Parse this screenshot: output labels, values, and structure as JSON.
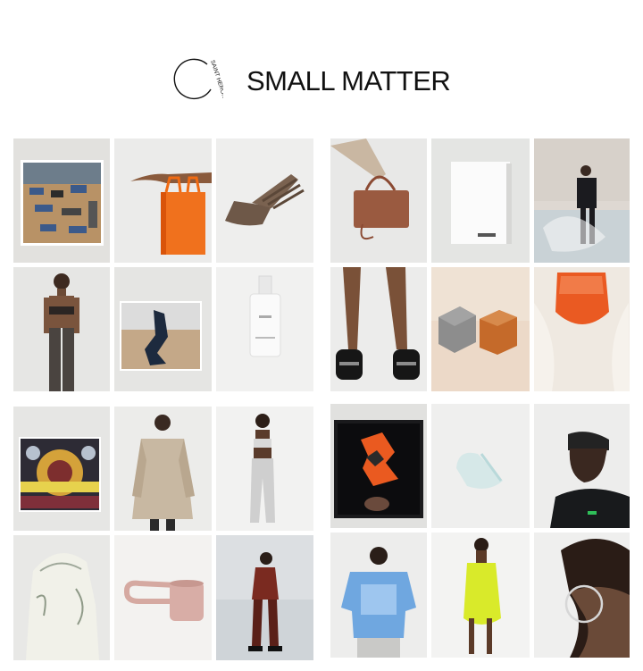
{
  "header": {
    "title": "SMALL MATTER",
    "logo_text": "SAINT HERON"
  },
  "grid": {
    "tiles": [
      {
        "name": "tile-classroom-photo"
      },
      {
        "name": "tile-orange-acrylic-bag"
      },
      {
        "name": "tile-wooden-comb"
      },
      {
        "name": "tile-brown-tote-bag"
      },
      {
        "name": "tile-white-book"
      },
      {
        "name": "tile-model-plastic-wrap"
      },
      {
        "name": "tile-model-bandeau"
      },
      {
        "name": "tile-photo-print-figure"
      },
      {
        "name": "tile-spray-bottle"
      },
      {
        "name": "tile-legs-black-loafers"
      },
      {
        "name": "tile-soap-cubes"
      },
      {
        "name": "tile-orange-resin-bag"
      },
      {
        "name": "tile-sun-ra-poster"
      },
      {
        "name": "tile-model-beige-coat"
      },
      {
        "name": "tile-model-silver-outfit"
      },
      {
        "name": "tile-framed-sculpture"
      },
      {
        "name": "tile-glass-ring"
      },
      {
        "name": "tile-model-bandana"
      },
      {
        "name": "tile-printed-hood"
      },
      {
        "name": "tile-pink-ceramic-cup"
      },
      {
        "name": "tile-model-red-outfit"
      },
      {
        "name": "tile-blue-tshirt"
      },
      {
        "name": "tile-yellow-dress"
      },
      {
        "name": "tile-hoop-earring"
      }
    ]
  }
}
